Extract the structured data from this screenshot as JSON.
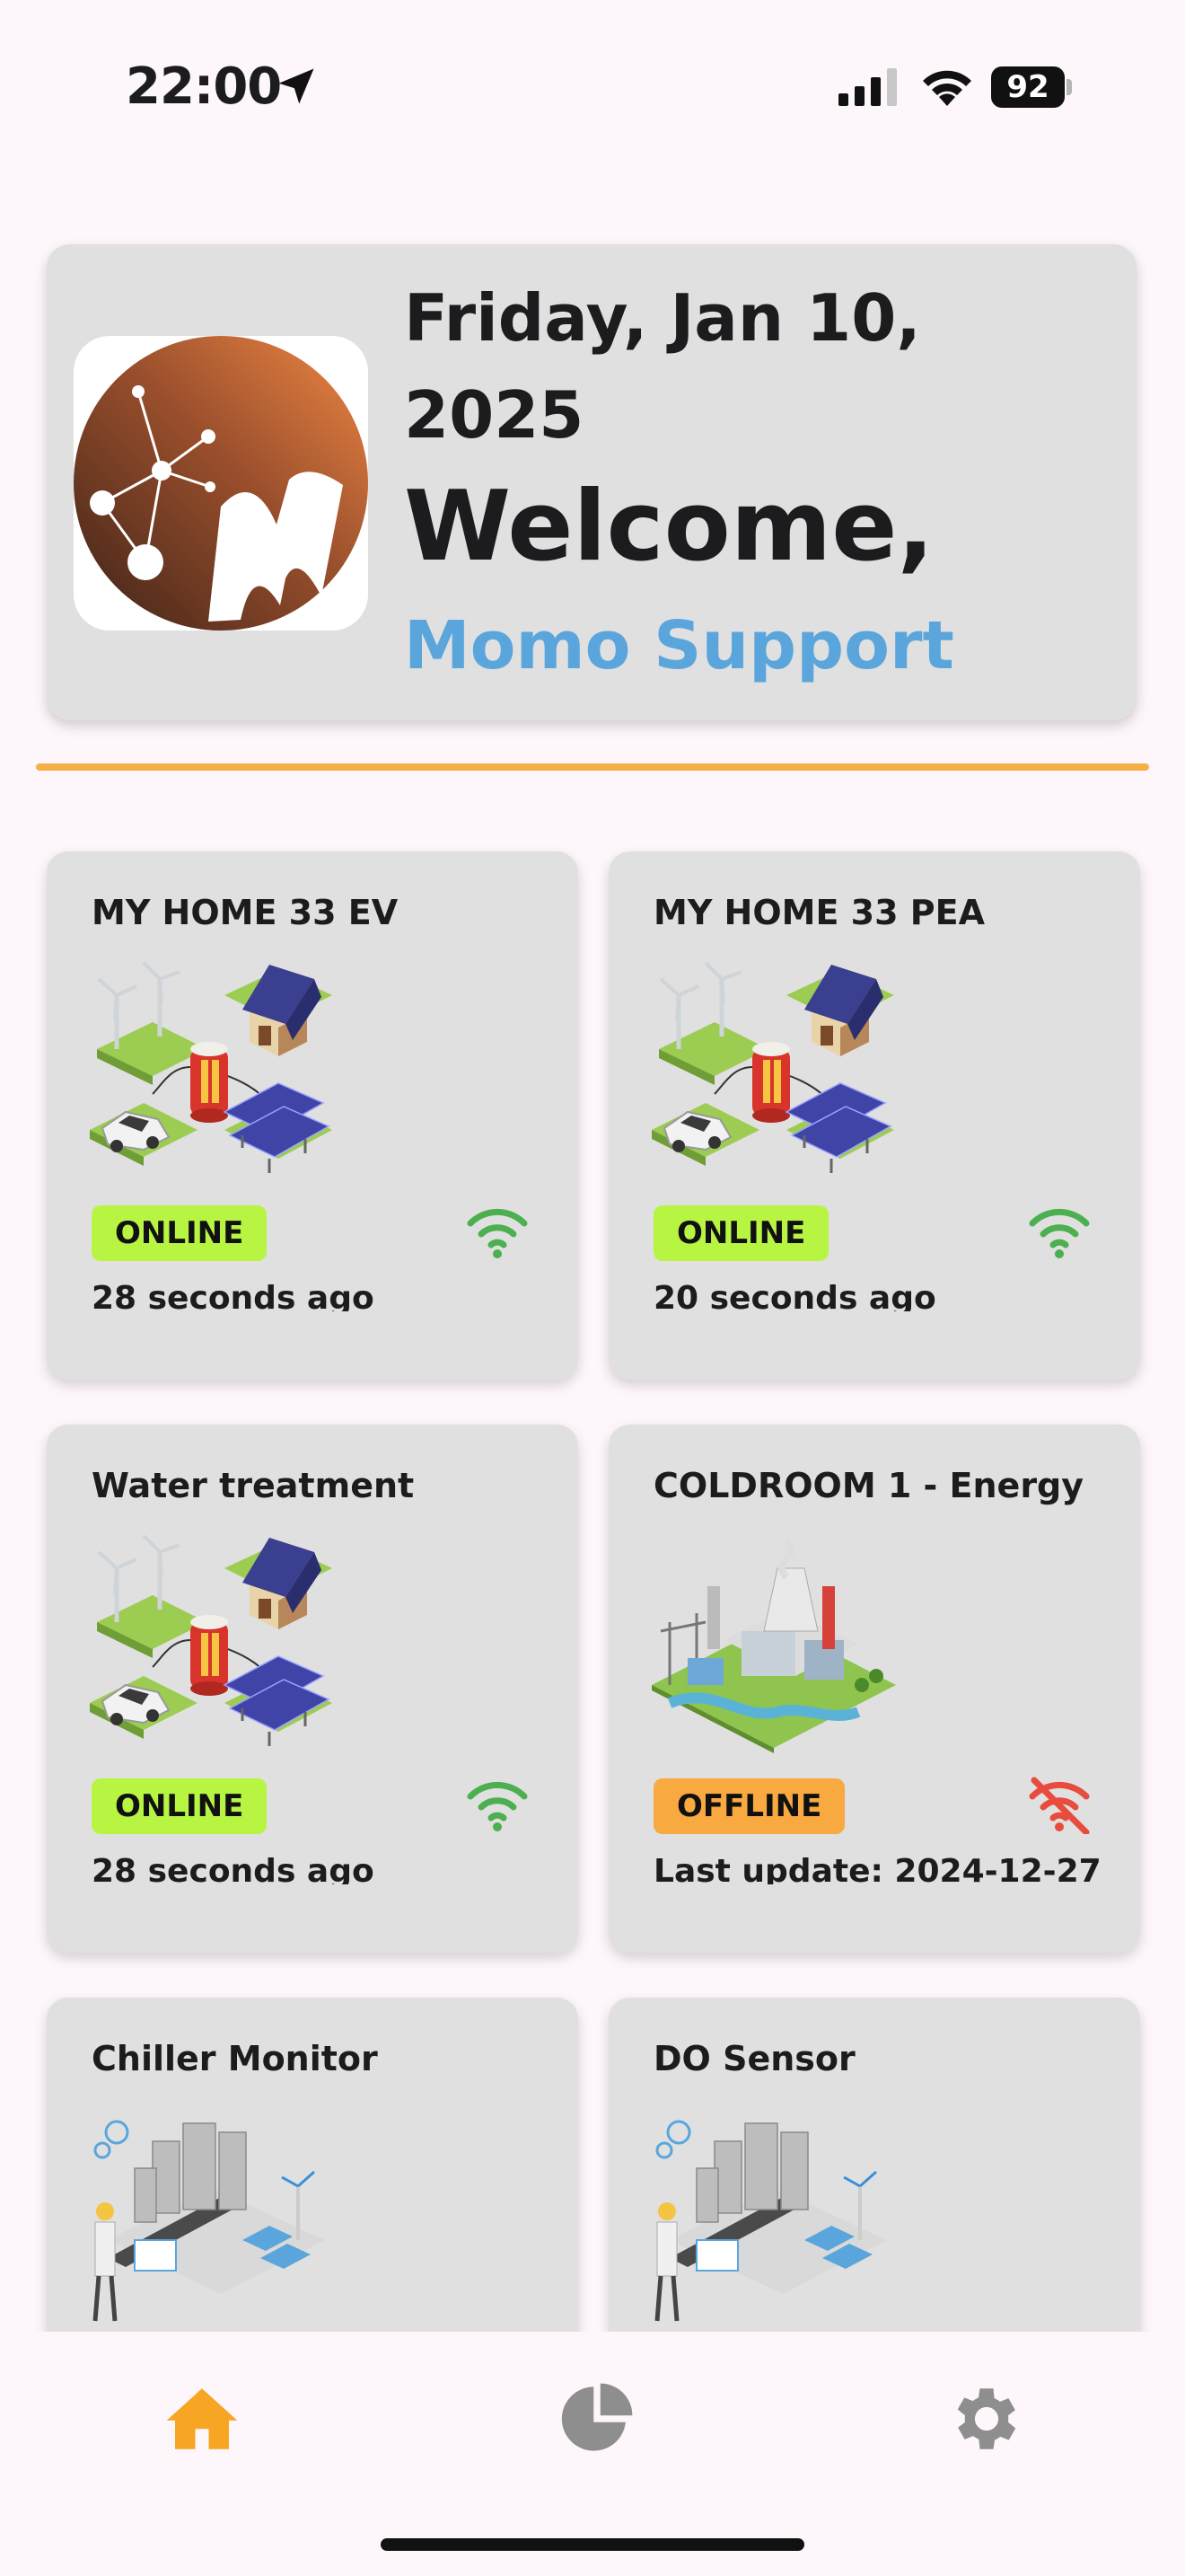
{
  "status_bar": {
    "time": "22:00",
    "battery": "92",
    "icons": [
      "location-arrow-icon",
      "cellular-signal-icon",
      "wifi-icon",
      "battery-icon"
    ]
  },
  "header": {
    "date": "Friday, Jan 10, 2025",
    "welcome": "Welcome,",
    "user_name": "Momo Support",
    "user_name_color": "#5aa6dc",
    "logo": "app-logo"
  },
  "accent_color": "#f6b046",
  "devices": [
    {
      "name": "MY HOME 33 EV",
      "status": "ONLINE",
      "updated": "28 seconds ago",
      "connection": "wifi-connected-icon",
      "illustration": "energy-home-illustration"
    },
    {
      "name": "MY HOME 33 PEA",
      "status": "ONLINE",
      "updated": "20 seconds ago",
      "connection": "wifi-connected-icon",
      "illustration": "energy-home-illustration"
    },
    {
      "name": "Water treatment",
      "status": "ONLINE",
      "updated": "28 seconds ago",
      "connection": "wifi-connected-icon",
      "illustration": "energy-home-illustration"
    },
    {
      "name": "COLDROOM 1 - Energy",
      "status": "OFFLINE",
      "updated": "Last update: 2024-12-27",
      "connection": "wifi-off-icon",
      "illustration": "factory-illustration"
    },
    {
      "name": "Chiller Monitor",
      "illustration": "smart-city-illustration"
    },
    {
      "name": "DO Sensor",
      "illustration": "smart-city-illustration"
    }
  ],
  "status_colors": {
    "online": "#b7f542",
    "offline": "#f8a93f",
    "wifi_on": "#4caf50",
    "wifi_off": "#e84c3d"
  },
  "tab_bar": {
    "tabs": [
      {
        "name": "home",
        "icon": "home-icon",
        "active": true,
        "color": "#f6a623"
      },
      {
        "name": "reports",
        "icon": "pie-chart-icon",
        "active": false,
        "color": "#8e8e8e"
      },
      {
        "name": "settings",
        "icon": "gear-icon",
        "active": false,
        "color": "#8e8e8e"
      }
    ]
  }
}
